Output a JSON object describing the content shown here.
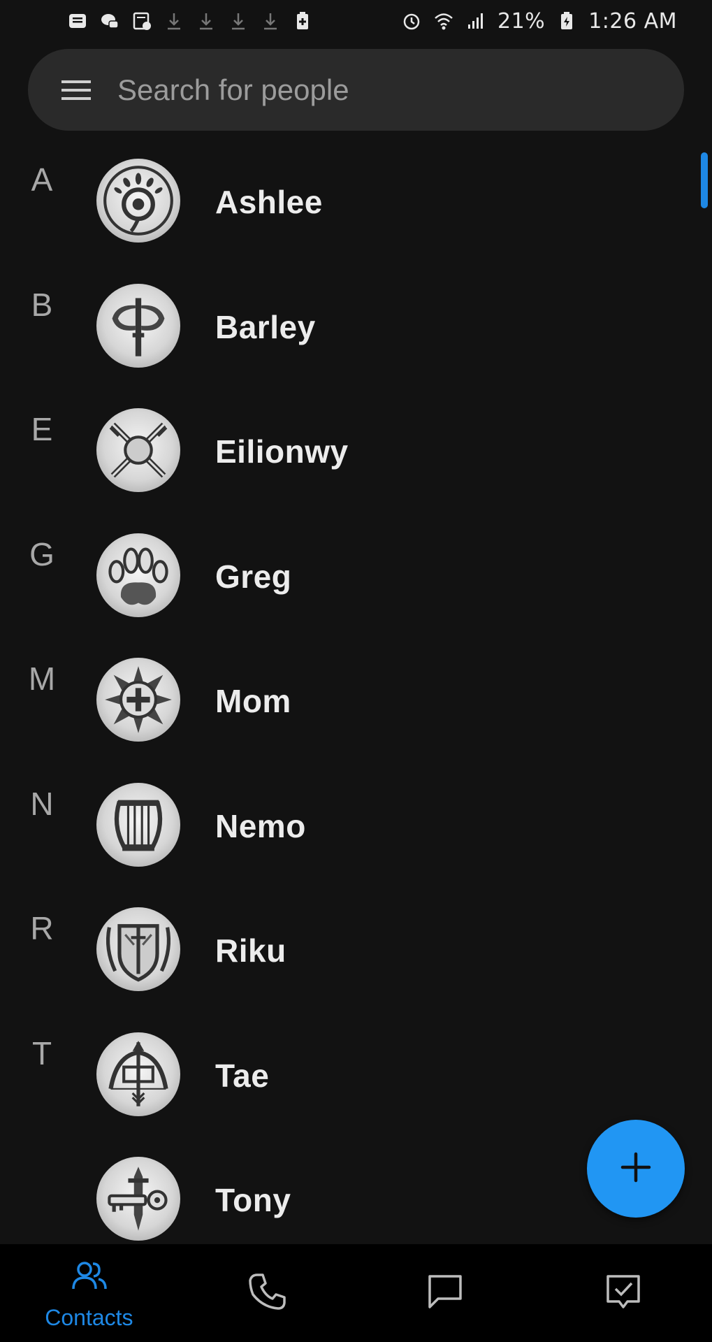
{
  "status_bar": {
    "battery_percent": "21%",
    "time": "1:26 AM",
    "left_icons": [
      "message-icon",
      "cloud-chat-icon",
      "news-alert-icon",
      "download-icon",
      "download-icon",
      "download-icon",
      "download-icon",
      "battery-plus-icon"
    ],
    "right_icons": [
      "alarm-icon",
      "wifi-icon",
      "signal-icon",
      "battery-charging-icon"
    ]
  },
  "search": {
    "placeholder": "Search for people"
  },
  "contacts": [
    {
      "letter": "A",
      "name": "Ashlee",
      "avatar_icon": "eye-crest-icon"
    },
    {
      "letter": "B",
      "name": "Barley",
      "avatar_icon": "battle-axe-icon"
    },
    {
      "letter": "E",
      "name": "Eilionwy",
      "avatar_icon": "crossed-swords-shield-icon"
    },
    {
      "letter": "G",
      "name": "Greg",
      "avatar_icon": "paw-print-icon"
    },
    {
      "letter": "M",
      "name": "Mom",
      "avatar_icon": "cross-compass-icon"
    },
    {
      "letter": "N",
      "name": "Nemo",
      "avatar_icon": "lyre-icon"
    },
    {
      "letter": "R",
      "name": "Riku",
      "avatar_icon": "winged-shield-sword-icon"
    },
    {
      "letter": "T",
      "name": "Tae",
      "avatar_icon": "bow-arrow-icon"
    },
    {
      "letter": "",
      "name": "Tony",
      "avatar_icon": "dagger-key-icon"
    }
  ],
  "fab": {
    "icon": "plus-icon"
  },
  "bottom_nav": {
    "items": [
      {
        "label": "Contacts",
        "icon": "people-icon",
        "active": true
      },
      {
        "label": "",
        "icon": "phone-icon",
        "active": false
      },
      {
        "label": "",
        "icon": "chat-icon",
        "active": false
      },
      {
        "label": "",
        "icon": "task-check-icon",
        "active": false
      }
    ]
  },
  "colors": {
    "background": "#121212",
    "search_bg": "#2a2a2a",
    "accent": "#2196f3",
    "nav_active": "#1e88e5"
  }
}
